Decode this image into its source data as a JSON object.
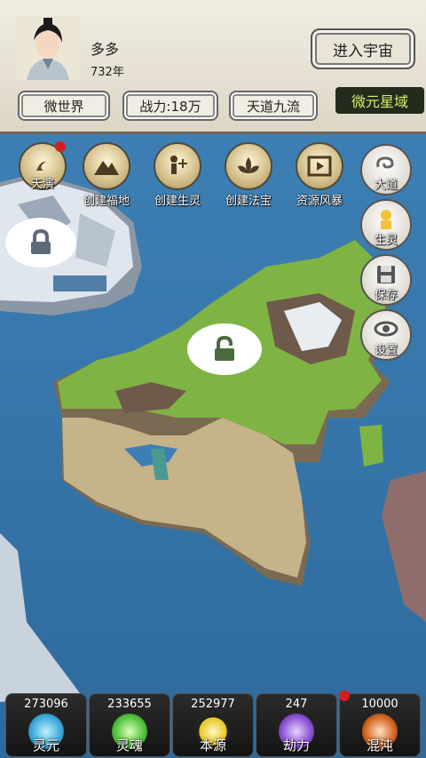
{
  "player": {
    "name": "多多",
    "age": "732年"
  },
  "header": {
    "enter_universe": "进入宇宙",
    "tags": [
      "微世界",
      "战力:18万",
      "天道九流"
    ],
    "realm": "微元星域"
  },
  "actions": [
    {
      "label": "天演",
      "icon": "tianyan-icon",
      "badge": true
    },
    {
      "label": "创建福地",
      "icon": "mountain-icon"
    },
    {
      "label": "创建生灵",
      "icon": "figure-plus-icon"
    },
    {
      "label": "创建法宝",
      "icon": "lotus-icon"
    },
    {
      "label": "资源风暴",
      "icon": "film-play-icon"
    }
  ],
  "side": [
    {
      "label": "大道",
      "icon": "cloud-swirl-icon"
    },
    {
      "label": "生灵",
      "icon": "character-icon"
    },
    {
      "label": "保存",
      "icon": "floppy-icon"
    },
    {
      "label": "设置",
      "icon": "eye-gear-icon"
    }
  ],
  "resources": [
    {
      "value": "273096",
      "label": "灵元",
      "color": "#3aa7d9"
    },
    {
      "value": "233655",
      "label": "灵魂",
      "color": "#4fbf3a"
    },
    {
      "value": "252977",
      "label": "本源",
      "color": "#e5c51a"
    },
    {
      "value": "247",
      "label": "劫力",
      "color": "#8a4fd1"
    },
    {
      "value": "10000",
      "label": "混沌",
      "color": "#d2631f",
      "badge": true
    }
  ]
}
